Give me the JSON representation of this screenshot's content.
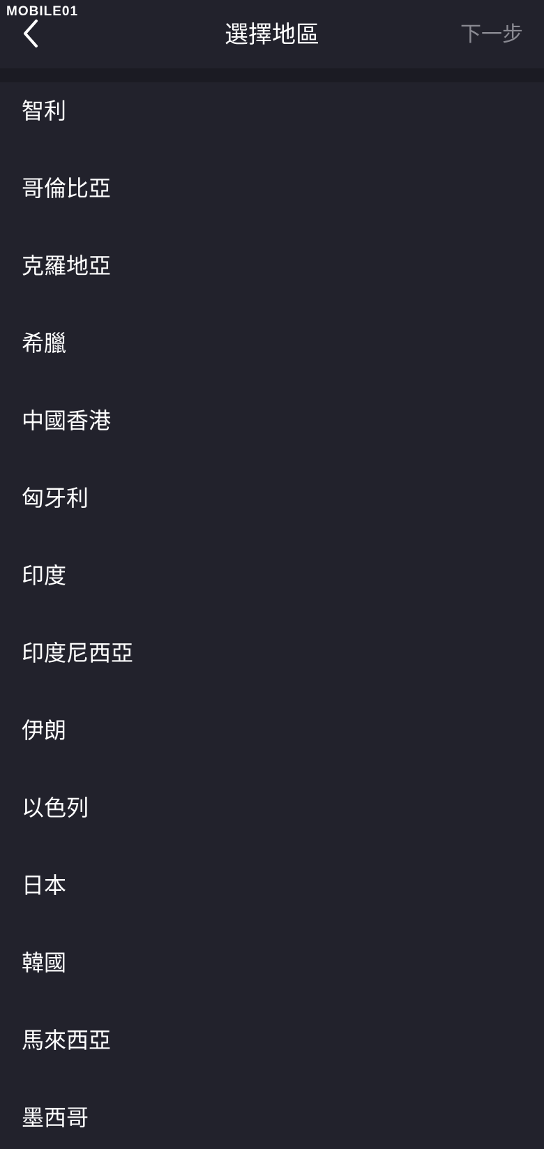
{
  "watermark": "MOBILE01",
  "header": {
    "title": "選擇地區",
    "next_label": "下一步"
  },
  "regions": [
    "智利",
    "哥倫比亞",
    "克羅地亞",
    "希臘",
    "中國香港",
    "匈牙利",
    "印度",
    "印度尼西亞",
    "伊朗",
    "以色列",
    "日本",
    "韓國",
    "馬來西亞",
    "墨西哥"
  ],
  "icons": {
    "back": "chevron-left-icon"
  },
  "colors": {
    "background": "#22222c",
    "band": "#1b1b23",
    "text": "#ffffff",
    "disabled_text": "#8a8a92"
  }
}
